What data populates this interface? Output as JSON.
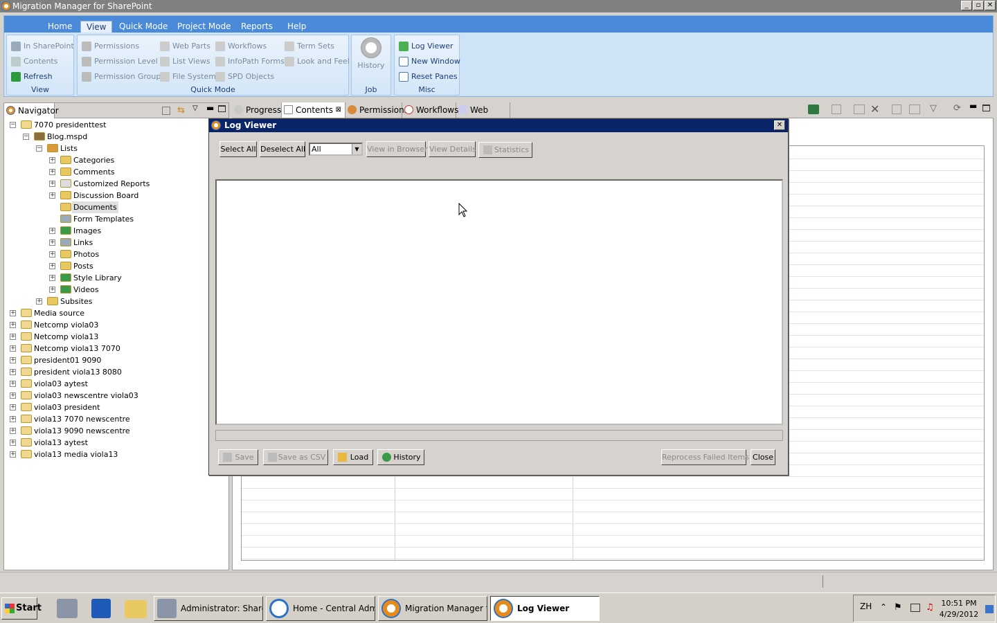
{
  "app": {
    "title": "Migration Manager for SharePoint",
    "window_buttons": [
      "_",
      "▫",
      "✕"
    ]
  },
  "ribbon": {
    "tabs": [
      "Home",
      "View",
      "Quick Mode",
      "Project Mode",
      "Reports",
      "Help"
    ],
    "active_tab": "View",
    "groups": {
      "view": {
        "title": "View",
        "items": [
          "In SharePoint",
          "Contents",
          "Refresh"
        ]
      },
      "quickmode": {
        "title": "Quick Mode",
        "items": [
          "Permissions",
          "Permission Level",
          "Permission Groups",
          "Web Parts",
          "List Views",
          "File System",
          "Workflows",
          "InfoPath Forms",
          "SPD Objects",
          "Term Sets",
          "Look and Feel"
        ]
      },
      "job": {
        "title": "Job",
        "items": [
          "History"
        ]
      },
      "misc": {
        "title": "Misc",
        "items": [
          "Log Viewer",
          "New Window",
          "Reset Panes"
        ]
      }
    }
  },
  "navigator": {
    "tab_label": "Navigator",
    "tree": [
      {
        "label": "7070 presidenttest",
        "level": 0,
        "exp": "−"
      },
      {
        "label": "Blog.mspd",
        "level": 1,
        "exp": "−"
      },
      {
        "label": "Lists",
        "level": 2,
        "exp": "−"
      },
      {
        "label": "Categories",
        "level": 3,
        "exp": "+"
      },
      {
        "label": "Comments",
        "level": 3,
        "exp": "+"
      },
      {
        "label": "Customized Reports",
        "level": 3,
        "exp": "+"
      },
      {
        "label": "Discussion Board",
        "level": 3,
        "exp": "+"
      },
      {
        "label": "Documents",
        "level": 3,
        "exp": ""
      },
      {
        "label": "Form Templates",
        "level": 3,
        "exp": ""
      },
      {
        "label": "Images",
        "level": 3,
        "exp": "+"
      },
      {
        "label": "Links",
        "level": 3,
        "exp": "+"
      },
      {
        "label": "Photos",
        "level": 3,
        "exp": "+"
      },
      {
        "label": "Posts",
        "level": 3,
        "exp": "+"
      },
      {
        "label": "Style Library",
        "level": 3,
        "exp": "+"
      },
      {
        "label": "Videos",
        "level": 3,
        "exp": "+"
      },
      {
        "label": "Subsites",
        "level": 2,
        "exp": "+"
      },
      {
        "label": "Media source",
        "level": 0,
        "exp": "+"
      },
      {
        "label": "Netcomp viola03",
        "level": 0,
        "exp": "+"
      },
      {
        "label": "Netcomp viola13",
        "level": 0,
        "exp": "+"
      },
      {
        "label": "Netcomp viola13 7070",
        "level": 0,
        "exp": "+"
      },
      {
        "label": "president01 9090",
        "level": 0,
        "exp": "+"
      },
      {
        "label": "president viola13 8080",
        "level": 0,
        "exp": "+"
      },
      {
        "label": "viola03 aytest",
        "level": 0,
        "exp": "+"
      },
      {
        "label": "viola03 newscentre viola03",
        "level": 0,
        "exp": "+"
      },
      {
        "label": "viola03 president",
        "level": 0,
        "exp": "+"
      },
      {
        "label": "viola13 7070 newscentre",
        "level": 0,
        "exp": "+"
      },
      {
        "label": "viola13 9090 newscentre",
        "level": 0,
        "exp": "+"
      },
      {
        "label": "viola13 aytest",
        "level": 0,
        "exp": "+"
      },
      {
        "label": "viola13 media viola13",
        "level": 0,
        "exp": "+"
      }
    ]
  },
  "view_tabs": [
    "Progress",
    "Contents",
    "Permissions",
    "Workflows",
    "Web Parts"
  ],
  "dialog": {
    "title": "Log Viewer",
    "close_glyph": "✕",
    "toolbar": {
      "select_all": "Select All",
      "deselect_all": "Deselect All",
      "filter_value": "All",
      "view_in_browser": "View in Browser",
      "view_details": "View Details",
      "statistics": "Statistics"
    },
    "footer": {
      "save": "Save",
      "save_csv": "Save as CSV",
      "load": "Load",
      "history": "History",
      "reprocess": "Reprocess Failed Items",
      "close": "Close"
    }
  },
  "taskbar": {
    "start": "Start",
    "tasks": [
      "Administrator: Share...",
      "Home - Central Admin...",
      "Migration Manager fo...",
      "Log Viewer"
    ],
    "active_task": "Log Viewer",
    "lang": "ZH",
    "time": "10:51 PM",
    "date": "4/29/2012"
  },
  "colors": {
    "ribbon_tab_bar": "#4a8ad8",
    "dialog_title": "#0a246a",
    "window_title": "#808080"
  }
}
